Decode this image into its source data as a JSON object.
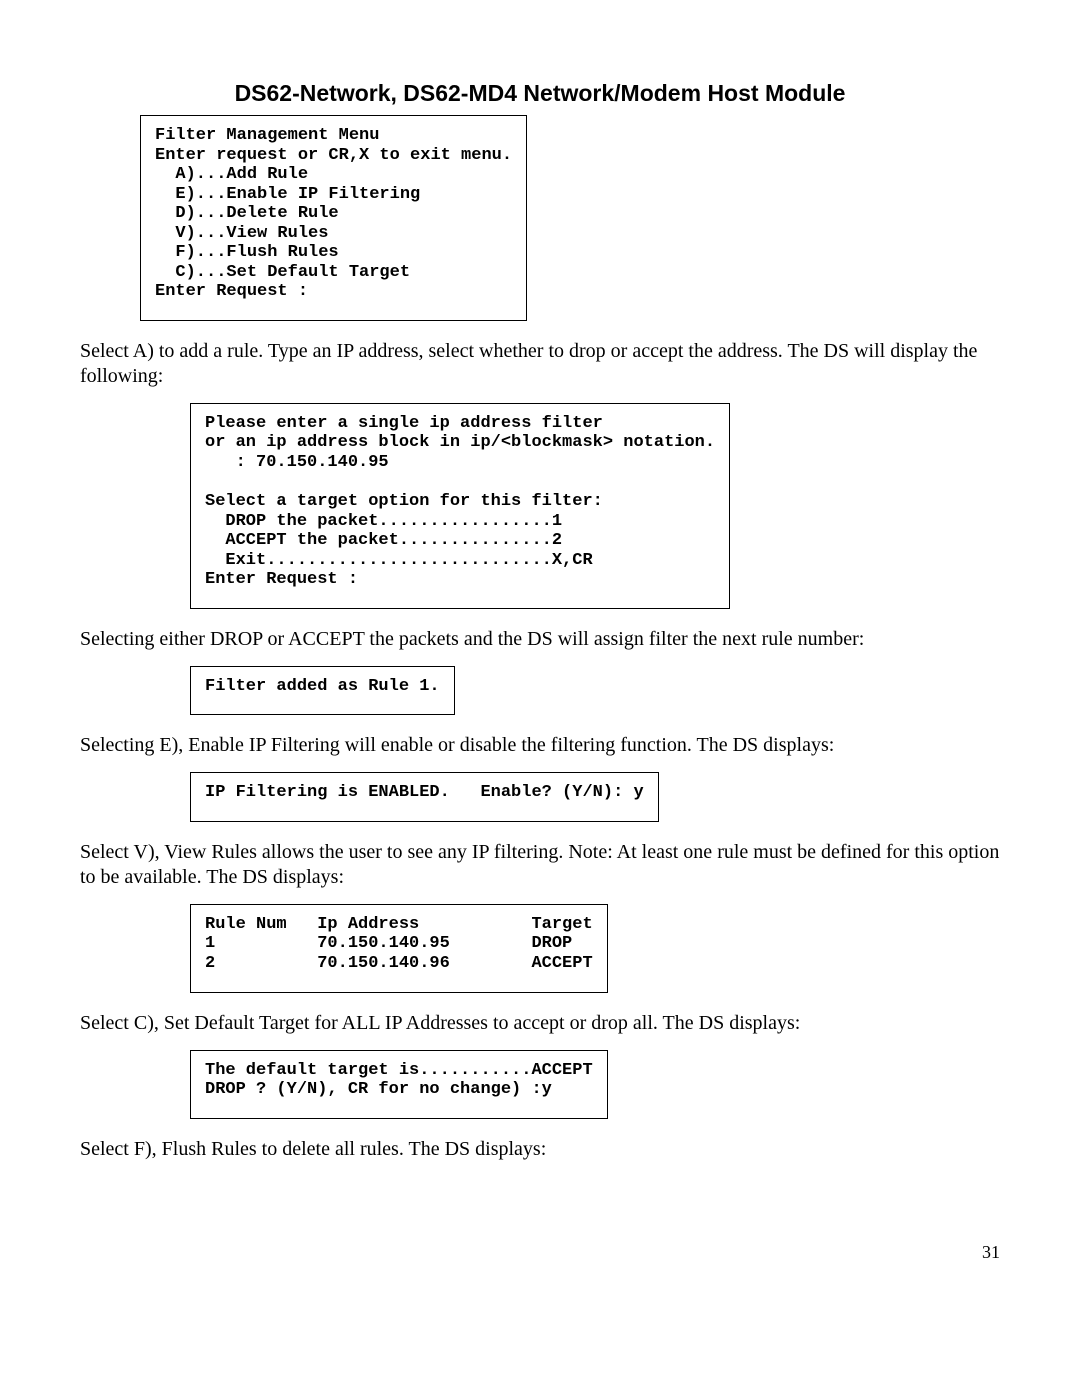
{
  "title": "DS62-Network, DS62-MD4 Network/Modem Host Module",
  "box1": "Filter Management Menu\nEnter request or CR,X to exit menu.\n  A)...Add Rule\n  E)...Enable IP Filtering\n  D)...Delete Rule\n  V)...View Rules\n  F)...Flush Rules\n  C)...Set Default Target\nEnter Request :",
  "para1": "Select A) to add a rule. Type an IP address, select whether to drop or accept the address. The DS will display the following:",
  "box2": "Please enter a single ip address filter\nor an ip address block in ip/<blockmask> notation.\n   : 70.150.140.95\n\nSelect a target option for this filter:\n  DROP the packet.................1\n  ACCEPT the packet...............2\n  Exit............................X,CR\nEnter Request :",
  "para2": "Selecting either DROP or ACCEPT the packets and the DS will assign filter the next rule number:",
  "box3": "Filter added as Rule 1.",
  "para3": "Selecting E), Enable IP Filtering will enable or disable the filtering function. The DS displays:",
  "box4": "IP Filtering is ENABLED.   Enable? (Y/N): y",
  "para4": "Select V), View Rules allows the user to see any IP filtering. Note: At least one rule must be defined for this option to be available. The DS displays:",
  "box5": "Rule Num   Ip Address           Target\n1          70.150.140.95        DROP\n2          70.150.140.96        ACCEPT",
  "para5": "Select C), Set Default Target for ALL IP Addresses to accept or drop all. The DS displays:",
  "box6": "The default target is...........ACCEPT\nDROP ? (Y/N), CR for no change) :y",
  "para6": "Select F), Flush Rules to delete all rules. The DS displays:",
  "page_number": "31"
}
